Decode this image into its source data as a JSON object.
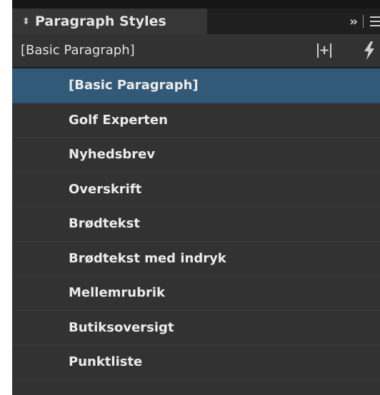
{
  "panel": {
    "tab_label": "Paragraph Styles",
    "updown_glyph": "⬍",
    "collapse_glyph": "››",
    "current_style": "[Basic Paragraph]",
    "new_style_glyph": "+",
    "icons": {
      "collapse": "double-chevron-right-icon",
      "menu": "panel-menu-icon",
      "new_style": "create-new-style-icon",
      "quick_apply": "lightning-bolt-icon"
    },
    "accent_color": "#325a78"
  },
  "styles": [
    {
      "label": "[Basic Paragraph]",
      "selected": true
    },
    {
      "label": "Golf Experten",
      "selected": false
    },
    {
      "label": "Nyhedsbrev",
      "selected": false
    },
    {
      "label": "Overskrift",
      "selected": false
    },
    {
      "label": "Brødtekst",
      "selected": false
    },
    {
      "label": "Brødtekst med indryk",
      "selected": false
    },
    {
      "label": "Mellemrubrik",
      "selected": false
    },
    {
      "label": "Butiksoversigt",
      "selected": false
    },
    {
      "label": "Punktliste",
      "selected": false
    }
  ]
}
